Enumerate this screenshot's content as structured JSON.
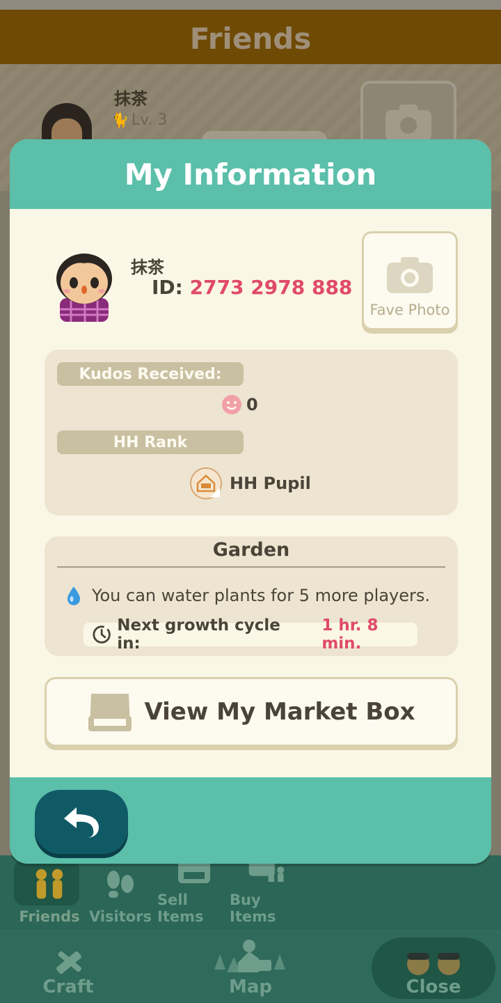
{
  "background": {
    "header_title": "Friends",
    "friend_name": "抹茶",
    "friend_level": "Lv. 3",
    "tabs": [
      {
        "label": "Friends",
        "icon": "friends-icon"
      },
      {
        "label": "Visitors",
        "icon": "footprints-icon"
      },
      {
        "label": "Sell Items",
        "icon": "sell-items-icon"
      },
      {
        "label": "Buy Items",
        "icon": "buy-items-icon"
      }
    ],
    "nav": {
      "craft": "Craft",
      "map": "Map",
      "close": "Close"
    }
  },
  "modal": {
    "title": "My Information",
    "profile": {
      "name": "抹茶",
      "id_label": "ID:",
      "id_value": "2773 2978 888",
      "fave_photo_label": "Fave Photo"
    },
    "kudos": {
      "label": "Kudos Received:",
      "value": "0"
    },
    "rank": {
      "label": "HH Rank",
      "value": "HH Pupil"
    },
    "garden": {
      "title": "Garden",
      "water_text": "You can water plants for 5 more players.",
      "timer_label": "Next growth cycle in:",
      "timer_value": "1 hr. 8 min."
    },
    "market_button_label": "View My Market Box"
  },
  "colors": {
    "accent_teal": "#5bbfaa",
    "back_button": "#105a66",
    "highlight_red": "#e04a6a",
    "panel": "#ede5d1"
  }
}
